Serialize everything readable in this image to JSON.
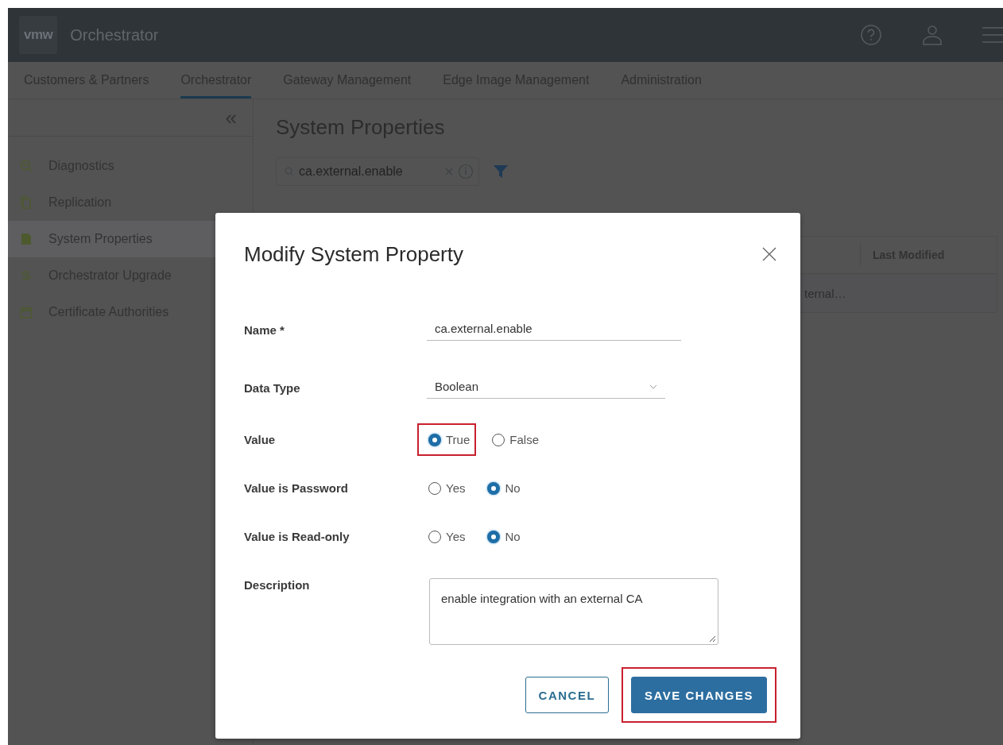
{
  "header": {
    "logo": "vmw",
    "app_title": "Orchestrator"
  },
  "nav_tabs": [
    {
      "label": "Customers & Partners",
      "selected": false
    },
    {
      "label": "Orchestrator",
      "selected": true
    },
    {
      "label": "Gateway Management",
      "selected": false
    },
    {
      "label": "Edge Image Management",
      "selected": false
    },
    {
      "label": "Administration",
      "selected": false
    }
  ],
  "sidebar": {
    "collapse": "«",
    "items": [
      {
        "label": "Diagnostics",
        "kind": "diagnostics",
        "selected": false
      },
      {
        "label": "Replication",
        "kind": "replication",
        "selected": false
      },
      {
        "label": "System Properties",
        "kind": "properties",
        "selected": true
      },
      {
        "label": "Orchestrator Upgrade",
        "kind": "upgrade",
        "selected": false
      },
      {
        "label": "Certificate Authorities",
        "kind": "certificates",
        "selected": false
      }
    ]
  },
  "page": {
    "title": "System Properties",
    "search": {
      "value": "ca.external.enable"
    },
    "table": {
      "columns": [
        "",
        "Last Modified"
      ],
      "rows": [
        {
          "cells": [
            "ternal…",
            ""
          ]
        }
      ]
    }
  },
  "dialog": {
    "title": "Modify System Property",
    "fields": [
      {
        "kind": "text",
        "label": "Name *",
        "value": "ca.external.enable"
      },
      {
        "kind": "select",
        "label": "Data Type",
        "value": "Boolean"
      },
      {
        "kind": "radio",
        "label": "Value",
        "options": [
          {
            "label": "True",
            "selected": true,
            "highlighted": true
          },
          {
            "label": "False",
            "selected": false,
            "highlighted": false
          }
        ]
      },
      {
        "kind": "radio",
        "label": "Value is Password",
        "options": [
          {
            "label": "Yes",
            "selected": false,
            "highlighted": false
          },
          {
            "label": "No",
            "selected": true,
            "highlighted": false
          }
        ]
      },
      {
        "kind": "radio",
        "label": "Value is Read-only",
        "options": [
          {
            "label": "Yes",
            "selected": false,
            "highlighted": false
          },
          {
            "label": "No",
            "selected": true,
            "highlighted": false
          }
        ]
      },
      {
        "kind": "textarea",
        "label": "Description",
        "value": "enable integration with an external CA"
      }
    ],
    "buttons": [
      {
        "label": "CANCEL",
        "kind": "secondary",
        "highlighted": false
      },
      {
        "label": "SAVE CHANGES",
        "kind": "primary",
        "highlighted": true
      }
    ]
  }
}
